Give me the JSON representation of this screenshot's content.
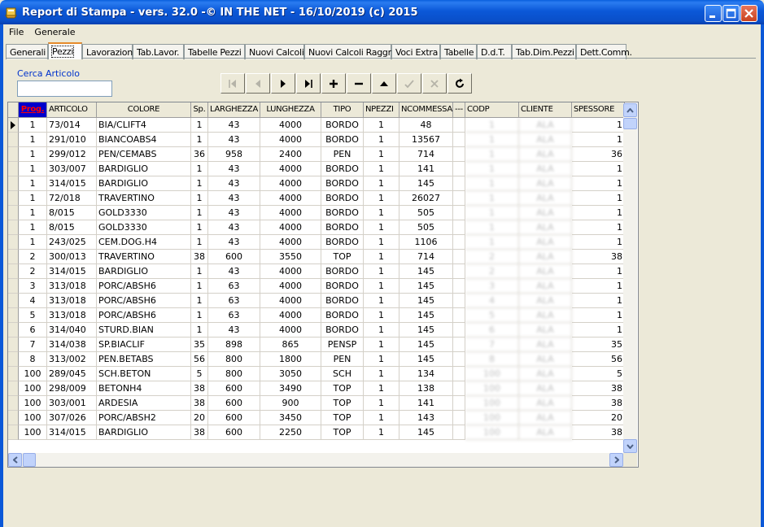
{
  "window": {
    "title": "Report di Stampa - vers. 32.0 -© IN THE NET - 16/10/2019 (c) 2015"
  },
  "menu": [
    "File",
    "Generale"
  ],
  "tabs": [
    {
      "label": "Generali",
      "width": 52
    },
    {
      "label": "Pezzi",
      "width": 42
    },
    {
      "label": "Lavorazioni",
      "width": 62
    },
    {
      "label": "Tab.Lavor.",
      "width": 63
    },
    {
      "label": "Tabelle Pezzi",
      "width": 75
    },
    {
      "label": "Nuovi Calcoli",
      "width": 73
    },
    {
      "label": "Nuovi Calcoli Raggr.",
      "width": 107
    },
    {
      "label": "Voci Extra",
      "width": 60
    },
    {
      "label": "Tabelle",
      "width": 45
    },
    {
      "label": "D.d.T.",
      "width": 43
    },
    {
      "label": "Tab.Dim.Pezzi",
      "width": 79
    },
    {
      "label": "Dett.Comm.",
      "width": 62
    }
  ],
  "active_tab": 1,
  "search": {
    "label": "Cerca Articolo",
    "value": ""
  },
  "navigator": [
    {
      "name": "first-record-icon",
      "enabled": false
    },
    {
      "name": "prior-record-icon",
      "enabled": false
    },
    {
      "name": "next-record-icon",
      "enabled": true
    },
    {
      "name": "last-record-icon",
      "enabled": true
    },
    {
      "name": "insert-record-icon",
      "enabled": true
    },
    {
      "name": "delete-record-icon",
      "enabled": true
    },
    {
      "name": "edit-record-icon",
      "enabled": true
    },
    {
      "name": "post-edit-icon",
      "enabled": false
    },
    {
      "name": "cancel-edit-icon",
      "enabled": false
    },
    {
      "name": "refresh-data-icon",
      "enabled": true
    }
  ],
  "grid": {
    "columns": [
      {
        "label": "Prog.",
        "width": 35,
        "align": "c"
      },
      {
        "label": "ARTICOLO",
        "width": 61,
        "align": "l"
      },
      {
        "label": "COLORE",
        "width": 116,
        "align": "l"
      },
      {
        "label": "Sp.",
        "width": 21,
        "align": "c"
      },
      {
        "label": "LARGHEZZA",
        "width": 64,
        "align": "c"
      },
      {
        "label": "LUNGHEZZA",
        "width": 75,
        "align": "c"
      },
      {
        "label": "TIPO",
        "width": 52,
        "align": "c"
      },
      {
        "label": "NPEZZI",
        "width": 44,
        "align": "c"
      },
      {
        "label": "NCOMMESSA",
        "width": 66,
        "align": "c"
      },
      {
        "label": "---",
        "width": 15,
        "align": "c"
      },
      {
        "label": "CODP",
        "width": 66,
        "align": "blur"
      },
      {
        "label": "CLIENTE",
        "width": 65,
        "align": "blur"
      },
      {
        "label": "SPESSORE",
        "width": 65,
        "align": "r"
      }
    ],
    "rows": [
      [
        "1",
        "73/014",
        "BIA/CLIFT4",
        "1",
        "43",
        "4000",
        "BORDO",
        "1",
        "48",
        "",
        "1",
        "ALA",
        "1"
      ],
      [
        "1",
        "291/010",
        "BIANCOABS4",
        "1",
        "43",
        "4000",
        "BORDO",
        "1",
        "13567",
        "",
        "1",
        "ALA",
        "1"
      ],
      [
        "1",
        "299/012",
        "PEN/CEMABS",
        "36",
        "958",
        "2400",
        "PEN",
        "1",
        "714",
        "",
        "1",
        "ALA",
        "36"
      ],
      [
        "1",
        "303/007",
        "BARDIGLIO",
        "1",
        "43",
        "4000",
        "BORDO",
        "1",
        "141",
        "",
        "1",
        "ALA",
        "1"
      ],
      [
        "1",
        "314/015",
        "BARDIGLIO",
        "1",
        "43",
        "4000",
        "BORDO",
        "1",
        "145",
        "",
        "1",
        "ALA",
        "1"
      ],
      [
        "1",
        "72/018",
        "TRAVERTINO",
        "1",
        "43",
        "4000",
        "BORDO",
        "1",
        "26027",
        "",
        "1",
        "ALA",
        "1"
      ],
      [
        "1",
        "8/015",
        "GOLD3330",
        "1",
        "43",
        "4000",
        "BORDO",
        "1",
        "505",
        "",
        "1",
        "ALA",
        "1"
      ],
      [
        "1",
        "8/015",
        "GOLD3330",
        "1",
        "43",
        "4000",
        "BORDO",
        "1",
        "505",
        "",
        "1",
        "ALA",
        "1"
      ],
      [
        "1",
        "243/025",
        "CEM.DOG.H4",
        "1",
        "43",
        "4000",
        "BORDO",
        "1",
        "1106",
        "",
        "1",
        "ALA",
        "1"
      ],
      [
        "2",
        "300/013",
        "TRAVERTINO",
        "38",
        "600",
        "3550",
        "TOP",
        "1",
        "714",
        "",
        "2",
        "ALA",
        "38"
      ],
      [
        "2",
        "314/015",
        "BARDIGLIO",
        "1",
        "43",
        "4000",
        "BORDO",
        "1",
        "145",
        "",
        "2",
        "ALA",
        "1"
      ],
      [
        "3",
        "313/018",
        "PORC/ABSH6",
        "1",
        "63",
        "4000",
        "BORDO",
        "1",
        "145",
        "",
        "3",
        "ALA",
        "1"
      ],
      [
        "4",
        "313/018",
        "PORC/ABSH6",
        "1",
        "63",
        "4000",
        "BORDO",
        "1",
        "145",
        "",
        "4",
        "ALA",
        "1"
      ],
      [
        "5",
        "313/018",
        "PORC/ABSH6",
        "1",
        "63",
        "4000",
        "BORDO",
        "1",
        "145",
        "",
        "5",
        "ALA",
        "1"
      ],
      [
        "6",
        "314/040",
        "STURD.BIAN",
        "1",
        "43",
        "4000",
        "BORDO",
        "1",
        "145",
        "",
        "6",
        "ALA",
        "1"
      ],
      [
        "7",
        "314/038",
        "SP.BIACLIF",
        "35",
        "898",
        "865",
        "PENSP",
        "1",
        "145",
        "",
        "7",
        "ALA",
        "35"
      ],
      [
        "8",
        "313/002",
        "PEN.BETABS",
        "56",
        "800",
        "1800",
        "PEN",
        "1",
        "145",
        "",
        "8",
        "ALA",
        "56"
      ],
      [
        "100",
        "289/045",
        "SCH.BETON",
        "5",
        "800",
        "3050",
        "SCH",
        "1",
        "134",
        "",
        "100",
        "ALA",
        "5"
      ],
      [
        "100",
        "298/009",
        "BETONH4",
        "38",
        "600",
        "3490",
        "TOP",
        "1",
        "138",
        "",
        "100",
        "ALA",
        "38"
      ],
      [
        "100",
        "303/001",
        "ARDESIA",
        "38",
        "600",
        "900",
        "TOP",
        "1",
        "141",
        "",
        "100",
        "ALA",
        "38"
      ],
      [
        "100",
        "307/026",
        "PORC/ABSH2",
        "20",
        "600",
        "3450",
        "TOP",
        "1",
        "143",
        "",
        "100",
        "ALA",
        "20"
      ],
      [
        "100",
        "314/015",
        "BARDIGLIO",
        "38",
        "600",
        "2250",
        "TOP",
        "1",
        "145",
        "",
        "100",
        "ALA",
        "38"
      ]
    ]
  }
}
